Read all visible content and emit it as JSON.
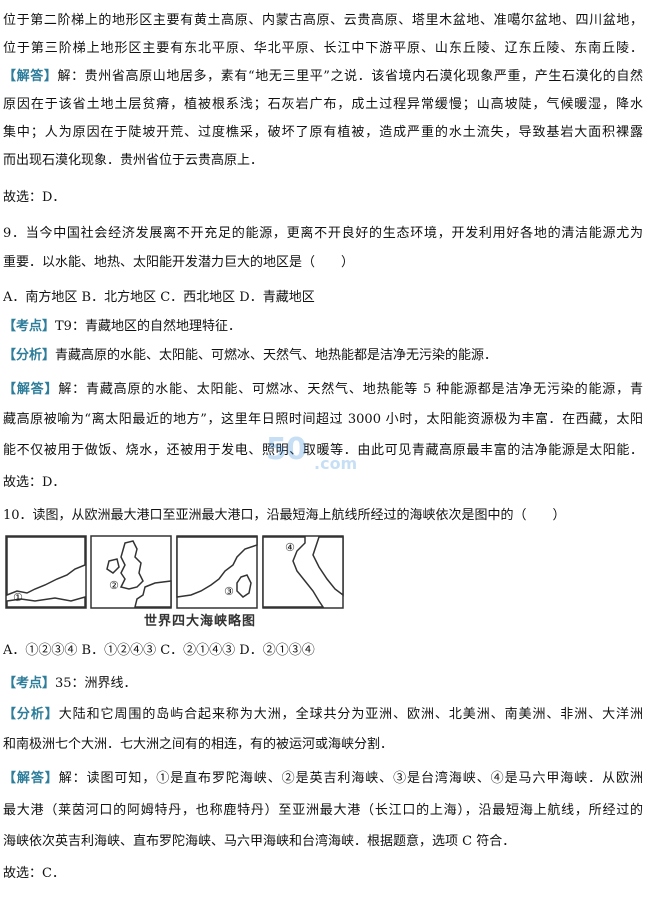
{
  "lines": {
    "l1": "位于第二阶梯上的地形区主要有黄土高原、内蒙古高原、云贵高原、塔里木盆地、准噶尔盆地、四川盆地，",
    "l2": "位于第三阶梯上地形区主要有东北平原、华北平原、长江中下游平原、山东丘陵、辽东丘陵、东南丘陵．",
    "l3_tag": "【解答】",
    "l3": "解：贵州省高原山地居多，素有“地无三里平”之说．该省境内石漠化现象严重，产生石漠化的自然",
    "l4": "原因在于该省土地土层贫瘠，植被根系浅；石灰岩广布，成土过程异常缓慢；山高坡陡，气候暖湿，降水",
    "l5": "集中；人为原因在于陡坡开荒、过度樵采，破坏了原有植被，造成严重的水土流失，导致基岩大面积裸露",
    "l6": "而出现石漠化现象．贵州省位于云贵高原上．",
    "l7": "故选：D．",
    "l8": "9．当今中国社会经济发展离不开充足的能源，更离不开良好的生态环境，开发利用好各地的清洁能源尤为",
    "l9": "重要．以水能、地热、太阳能开发潜力巨大的地区是（　　）",
    "l10": "A．南方地区  B．北方地区  C．西北地区  D．青藏地区",
    "l11_tag": "【考点】",
    "l11": "T9：青藏地区的自然地理特征．",
    "l12_tag": "【分析】",
    "l12": "青藏高原的水能、太阳能、可燃冰、天然气、地热能都是洁净无污染的能源．",
    "l13_tag": "【解答】",
    "l13": "解：青藏高原的水能、太阳能、可燃冰、天然气、地热能等 5 种能源都是洁净无污染的能源，青",
    "l14": "藏高原被喻为“离太阳最近的地方”，这里年日照时间超过 3000 小时，太阳能资源极为丰富．在西藏，太阳",
    "l15": "能不仅被用于做饭、烧水，还被用于发电、照明、取暖等．由此可见青藏高原最丰富的洁净能源是太阳能．",
    "l16": "故选：D．",
    "l17": "10．读图，从欧洲最大港口至亚洲最大港口，沿最短海上航线所经过的海峡依次是图中的（　　）",
    "l18": "A．①②③④  B．①②④③  C．②①④③  D．②①③④",
    "l19_tag": "【考点】",
    "l19": "35：洲界线．",
    "l20_tag": "【分析】",
    "l20": "大陆和它周围的岛屿合起来称为大洲，全球共分为亚洲、欧洲、北美洲、南美洲、非洲、大洋洲",
    "l21": "和南极洲七个大洲．七大洲之间有的相连，有的被运河或海峡分割．",
    "l22_tag": "【解答】",
    "l22": "解：读图可知，①是直布罗陀海峡、②是英吉利海峡、③是台湾海峡、④是马六甲海峡．从欧洲",
    "l23": "最大港（莱茵河口的阿姆特丹，也称鹿特丹）至亚洲最大港（长江口的上海），沿最短海上航线，所经过的",
    "l24": "海峡依次英吉利海峡、直布罗陀海峡、马六甲海峡和台湾海峡．根据题意，选项 C 符合．",
    "l25": "故选：C．"
  },
  "figure": {
    "caption": "世界四大海峡略图",
    "labels": [
      "①",
      "②",
      "③",
      "④"
    ]
  },
  "watermark": {
    "main": "50",
    "sub": ".com"
  },
  "colors": {
    "tag": "#2e7d9a",
    "text": "#111111",
    "watermark": "#3a8fd8"
  }
}
